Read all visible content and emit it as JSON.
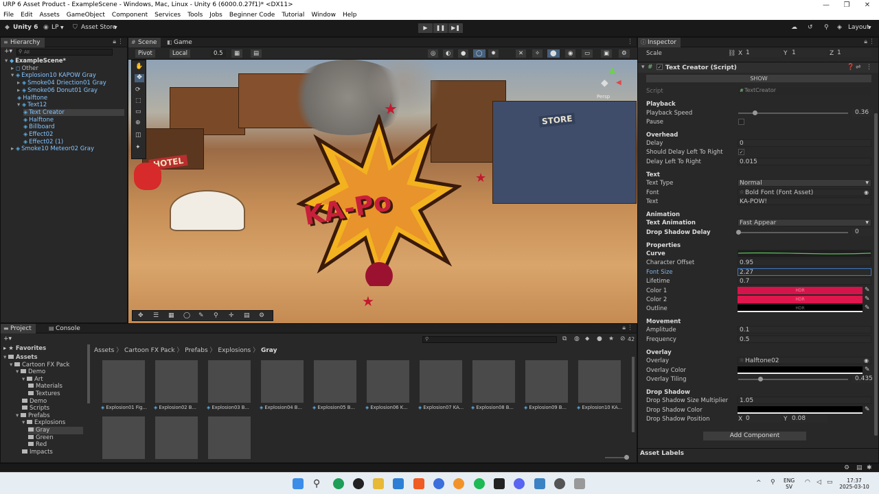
{
  "window": {
    "title": "URP 6 Asset Product - ExampleScene - Windows, Mac, Linux - Unity 6 (6000.0.27f1)* <DX11>"
  },
  "menu": [
    "File",
    "Edit",
    "Assets",
    "GameObject",
    "Component",
    "Services",
    "Tools",
    "Jobs",
    "Beginner Code",
    "Tutorial",
    "Window",
    "Help"
  ],
  "toolbar": {
    "unity_label": "Unity 6",
    "account": "LP",
    "asset_store": "Asset Store",
    "layout": "Layout"
  },
  "hierarchy": {
    "tab": "Hierarchy",
    "search_placeholder": "All",
    "rows": [
      {
        "label": "ExampleScene*",
        "indent": 0
      },
      {
        "label": "Other",
        "indent": 1
      },
      {
        "label": "Explosion10 KAPOW Gray",
        "indent": 1
      },
      {
        "label": "Smoke04 Driection01 Gray",
        "indent": 2
      },
      {
        "label": "Smoke06 Donut01 Gray",
        "indent": 2
      },
      {
        "label": "Halftone",
        "indent": 2
      },
      {
        "label": "Text12",
        "indent": 2
      },
      {
        "label": "Text Creator",
        "indent": 3
      },
      {
        "label": "Halftone",
        "indent": 3
      },
      {
        "label": "Billboard",
        "indent": 3
      },
      {
        "label": "Effect02",
        "indent": 3
      },
      {
        "label": "Effect02 (1)",
        "indent": 3
      },
      {
        "label": "Smoke10 Meteor02 Gray",
        "indent": 1
      }
    ]
  },
  "scene": {
    "tabs": [
      "Scene",
      "Game"
    ],
    "pivot": "Pivot",
    "local": "Local",
    "snap": "0.5",
    "kapow_text": "KA-Po",
    "hotel_sign": "HOTEL",
    "store_sign": "STORE",
    "gizmo_label": "Persp"
  },
  "project": {
    "tabs": [
      "Project",
      "Console"
    ],
    "favorites": "Favorites",
    "tree": [
      {
        "label": "Assets",
        "indent": 0,
        "bold": true
      },
      {
        "label": "Cartoon FX Pack",
        "indent": 1
      },
      {
        "label": "Demo",
        "indent": 2
      },
      {
        "label": "Art",
        "indent": 3
      },
      {
        "label": "Materials",
        "indent": 4
      },
      {
        "label": "Textures",
        "indent": 4
      },
      {
        "label": "Demo",
        "indent": 3
      },
      {
        "label": "Scripts",
        "indent": 3
      },
      {
        "label": "Prefabs",
        "indent": 2
      },
      {
        "label": "Explosions",
        "indent": 3
      },
      {
        "label": "Gray",
        "indent": 4
      },
      {
        "label": "Green",
        "indent": 4
      },
      {
        "label": "Red",
        "indent": 4
      },
      {
        "label": "Impacts",
        "indent": 3
      }
    ],
    "breadcrumb": [
      "Assets",
      "Cartoon FX Pack",
      "Prefabs",
      "Explosions",
      "Gray"
    ],
    "asset_count": "42",
    "assets": [
      "Explosion01 Fig...",
      "Explosion02 B...",
      "Explosion03 B...",
      "Explosion04 B...",
      "Explosion05 B...",
      "Explosion06 K...",
      "Explosion07 KA...",
      "Explosion08 B...",
      "Explosion09 B...",
      "Explosion10 KA...",
      "",
      "",
      ""
    ]
  },
  "inspector": {
    "tab": "Inspector",
    "scale": {
      "label": "Scale",
      "x": "1",
      "y": "1",
      "z": "1"
    },
    "component": "Text Creator (Script)",
    "show_button": "SHOW",
    "script": {
      "label": "Script",
      "value": "TextCreator"
    },
    "playback": {
      "header": "Playback",
      "speed_label": "Playback Speed",
      "speed": "0.36",
      "speed_fraction": 0.15,
      "pause_label": "Pause"
    },
    "overhead": {
      "header": "Overhead",
      "delay_label": "Delay",
      "delay": "0",
      "sdlr_label": "Should Delay Left To Right",
      "dlr_label": "Delay Left To Right",
      "dlr": "0.015"
    },
    "text": {
      "header": "Text",
      "type_label": "Text Type",
      "type": "Normal",
      "font_label": "Font",
      "font": "Bold Font (Font Asset)",
      "text_label": "Text",
      "text": "KA-POW!"
    },
    "animation": {
      "header": "Animation",
      "anim_label": "Text Animation",
      "anim": "Fast Appear",
      "shadow_delay_label": "Drop Shadow Delay",
      "shadow_delay": "0",
      "shadow_delay_fraction": 0.0
    },
    "properties": {
      "header": "Properties",
      "curve_label": "Curve",
      "char_offset_label": "Character Offset",
      "char_offset": "0.95",
      "font_size_label": "Font Size",
      "font_size": "2.27",
      "lifetime_label": "Lifetime",
      "lifetime": "0.7",
      "color1_label": "Color 1",
      "color2_label": "Color 2",
      "outline_label": "Outline",
      "hdr": "HDR",
      "color1": "#d4144a",
      "color2": "#e0174d"
    },
    "movement": {
      "header": "Movement",
      "amplitude_label": "Amplitude",
      "amplitude": "0.1",
      "frequency_label": "Frequency",
      "frequency": "0.5"
    },
    "overlay": {
      "header": "Overlay",
      "overlay_label": "Overlay",
      "overlay": "Halftone02",
      "color_label": "Overlay Color",
      "tiling_label": "Overlay Tiling",
      "tiling": "0.435",
      "tiling_fraction": 0.2
    },
    "drop_shadow": {
      "header": "Drop Shadow",
      "size_label": "Drop Shadow Size Multiplier",
      "size": "1.05",
      "color_label": "Drop Shadow Color",
      "pos_label": "Drop Shadow Position",
      "pos_x": "0",
      "pos_y": "0.08"
    },
    "add_component": "Add Component",
    "asset_labels": "Asset Labels"
  },
  "taskbar": {
    "lang1": "ENG",
    "lang2": "SV",
    "time": "17:37",
    "date": "2025-03-10"
  }
}
